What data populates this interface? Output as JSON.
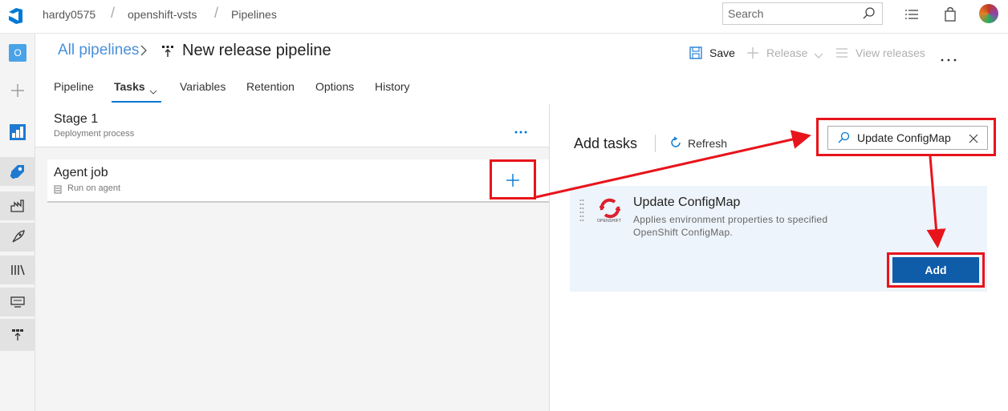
{
  "breadcrumb": {
    "org": "hardy0575",
    "sep1": "/",
    "project": "openshift-vsts",
    "sep2": "/",
    "section": "Pipelines"
  },
  "search": {
    "placeholder": "Search"
  },
  "rail": {
    "project_initial": "O"
  },
  "header": {
    "all_pipelines": "All pipelines",
    "title": "New release pipeline"
  },
  "commands": {
    "save": "Save",
    "release": "Release",
    "view_releases": "View releases"
  },
  "tabs": [
    {
      "label": "Pipeline"
    },
    {
      "label": "Tasks"
    },
    {
      "label": "Variables"
    },
    {
      "label": "Retention"
    },
    {
      "label": "Options"
    },
    {
      "label": "History"
    }
  ],
  "stage": {
    "name": "Stage 1",
    "subtitle": "Deployment process"
  },
  "agent_job": {
    "name": "Agent job",
    "subtitle": "Run on agent"
  },
  "add_tasks": {
    "title": "Add tasks",
    "refresh": "Refresh",
    "search_value": "Update ConfigMap"
  },
  "task": {
    "name": "Update ConfigMap",
    "description_line1": "Applies environment properties to specified",
    "description_line2": "OpenShift ConfigMap.",
    "logo_text": "OPENSHIFT",
    "add_label": "Add"
  },
  "colors": {
    "accent": "#0f5ca8",
    "highlight": "#e8141b",
    "link": "#4a90d9",
    "card_bg": "#eef4fb"
  }
}
